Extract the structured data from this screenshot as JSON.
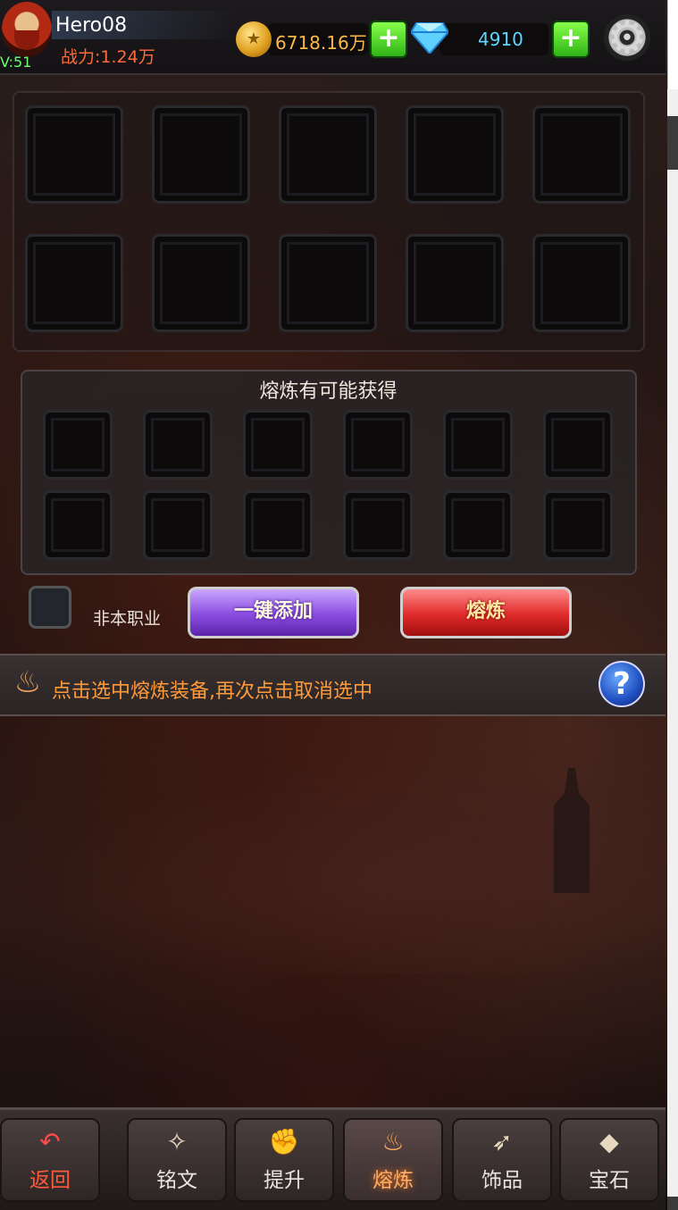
{
  "player": {
    "name": "Hero08",
    "level": "V:51",
    "power": "战力:1.24万"
  },
  "currency": {
    "gold": "6718.16万",
    "diamonds": "4910"
  },
  "icons": {
    "coin": "gold-coin-icon",
    "diamond": "blue-diamond-icon",
    "plus": "green-plus-icon",
    "settings": "gear-icon",
    "flame": "flame-icon",
    "help": "question-mark-icon"
  },
  "smelt": {
    "possible_rewards_title": "熔炼有可能获得",
    "non_class_label": "非本职业",
    "one_click_add": "一键添加",
    "smelt_button": "熔炼",
    "tip": "点击选中熔炼装备,再次点击取消选中"
  },
  "nav": [
    {
      "label": "返回",
      "icon": "back-arrow-icon"
    },
    {
      "label": "铭文",
      "icon": "inscription-icon"
    },
    {
      "label": "提升",
      "icon": "fist-icon"
    },
    {
      "label": "熔炼",
      "icon": "flame-icon"
    },
    {
      "label": "饰品",
      "icon": "accessory-icon"
    },
    {
      "label": "宝石",
      "icon": "gem-icon"
    }
  ],
  "colors": {
    "gold_text": "#ffb84a",
    "diamond_text": "#5fd6ff",
    "power_text": "#ff6a3a",
    "tip_text": "#ff9a3a",
    "add_button": "#8a4ce0",
    "smelt_button": "#e02a2a"
  }
}
